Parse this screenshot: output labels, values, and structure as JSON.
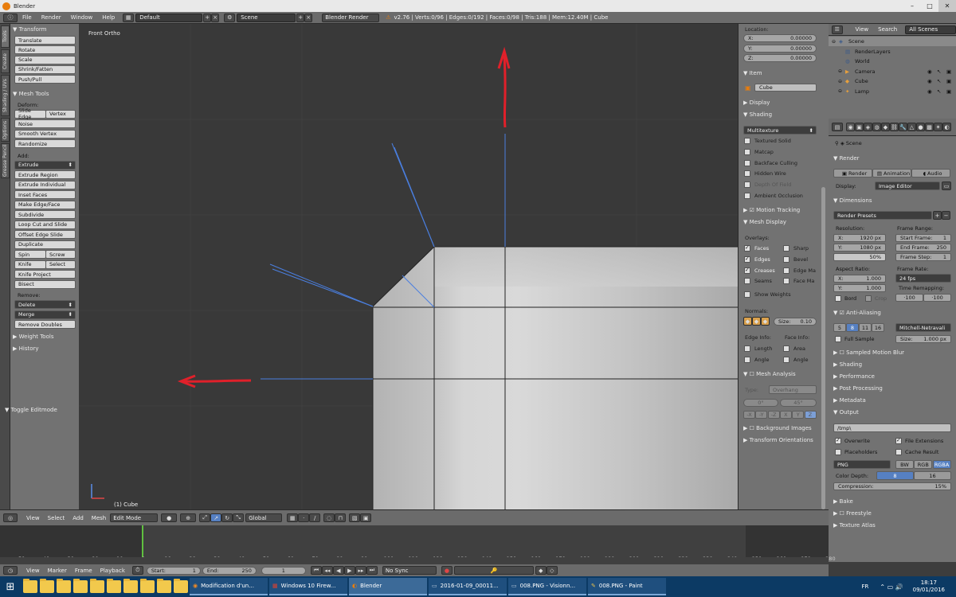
{
  "window": {
    "title": "Blender",
    "min": "–",
    "max": "□",
    "close": "✕"
  },
  "info_header": {
    "menus": [
      "File",
      "Render",
      "Window",
      "Help"
    ],
    "layout": "Default",
    "scene": "Scene",
    "engine": "Blender Render",
    "stats": "v2.76 | Verts:0/96 | Edges:0/192 | Faces:0/98 | Tris:188 | Mem:12.40M | Cube"
  },
  "tool_tabs": [
    "Tools",
    "Create",
    "Shading / UVs",
    "Options",
    "Grease Pencil"
  ],
  "tools": {
    "transform": {
      "title": "Transform",
      "buttons": [
        "Translate",
        "Rotate",
        "Scale",
        "Shrink/Fatten",
        "Push/Pull"
      ]
    },
    "mesh_tools": {
      "title": "Mesh Tools",
      "deform_label": "Deform:",
      "deform": [
        [
          "Slide Edge",
          "Vertex"
        ],
        [
          "Noise"
        ],
        [
          "Smooth Vertex"
        ],
        [
          "Randomize"
        ]
      ],
      "add_label": "Add:",
      "extrude": "Extrude",
      "add": [
        "Extrude Region",
        "Extrude Individual",
        "Inset Faces",
        "Make Edge/Face",
        "Subdivide",
        "Loop Cut and Slide",
        "Offset Edge Slide",
        "Duplicate"
      ],
      "pairs": [
        [
          "Spin",
          "Screw"
        ],
        [
          "Knife",
          "Select"
        ]
      ],
      "after_pairs": [
        "Knife Project",
        "Bisect"
      ],
      "remove_label": "Remove:",
      "delete": "Delete",
      "merge": "Merge",
      "remove_doubles": "Remove Doubles"
    },
    "weight_tools": "Weight Tools",
    "history": "History",
    "toggle": "Toggle Editmode"
  },
  "viewport": {
    "view_name": "Front Ortho",
    "object_label": "(1) Cube"
  },
  "n_panel": {
    "location_label": "Location:",
    "location": [
      {
        "axis": "X:",
        "value": "0.00000"
      },
      {
        "axis": "Y:",
        "value": "0.00000"
      },
      {
        "axis": "Z:",
        "value": "0.00000"
      }
    ],
    "item_title": "Item",
    "item_name": "Cube",
    "display_title": "Display",
    "shading_title": "Shading",
    "shading_mode": "Multitexture",
    "shading_opts": [
      "Textured Solid",
      "Matcap",
      "Backface Culling",
      "Hidden Wire",
      "Depth Of Field",
      "Ambient Occlusion"
    ],
    "motion_tracking": "Motion Tracking",
    "mesh_display_title": "Mesh Display",
    "overlays_label": "Overlays:",
    "overlays_left": [
      {
        "label": "Faces",
        "on": true
      },
      {
        "label": "Edges",
        "on": true
      },
      {
        "label": "Creases",
        "on": true
      },
      {
        "label": "Seams",
        "on": false
      }
    ],
    "overlays_right": [
      {
        "label": "Sharp",
        "on": false
      },
      {
        "label": "Bevel",
        "on": false
      },
      {
        "label": "Edge Ma",
        "on": false
      },
      {
        "label": "Face Ma",
        "on": false
      }
    ],
    "show_weights": "Show Weights",
    "normals_label": "Normals:",
    "normals_size": "Size:",
    "normals_size_value": "0.10",
    "edge_info": "Edge Info:",
    "face_info": "Face Info:",
    "edge_info_opts": [
      "Length",
      "Angle"
    ],
    "face_info_opts": [
      "Area",
      "Angle"
    ],
    "mesh_analysis": "Mesh Analysis",
    "type_label": "Type:",
    "type_value": "Overhang",
    "angle_min": "0°",
    "angle_max": "45°",
    "axes": [
      "-X",
      "-Y",
      "-Z",
      "X",
      "Y",
      "Z"
    ],
    "background_images": "Background Images",
    "transform_orientations": "Transform Orientations"
  },
  "outliner": {
    "menus": [
      "View",
      "Search"
    ],
    "filter": "All Scenes",
    "rows": [
      {
        "name": "Scene",
        "indent": 0
      },
      {
        "name": "RenderLayers",
        "indent": 1
      },
      {
        "name": "World",
        "indent": 1
      },
      {
        "name": "Camera",
        "indent": 1
      },
      {
        "name": "Cube",
        "indent": 1
      },
      {
        "name": "Lamp",
        "indent": 1
      }
    ]
  },
  "properties": {
    "breadcrumb": "Scene",
    "render_title": "Render",
    "render_btns": [
      "Render",
      "Animation",
      "Audio"
    ],
    "display_label": "Display:",
    "display_value": "Image Editor",
    "dimensions_title": "Dimensions",
    "render_presets": "Render Presets",
    "resolution_label": "Resolution:",
    "res_x": "1920 px",
    "res_y": "1080 px",
    "res_pct": "50%",
    "frame_range_label": "Frame Range:",
    "start_frame": "Start Frame:",
    "start_frame_value": "1",
    "end_frame": "End Frame:",
    "end_frame_value": "250",
    "frame_step": "Frame Step:",
    "frame_step_value": "1",
    "aspect_label": "Aspect Ratio:",
    "aspect_x": "1.000",
    "aspect_y": "1.000",
    "frame_rate_label": "Frame Rate:",
    "frame_rate": "24 fps",
    "time_remap_label": "Time Remapping:",
    "time_old": "·100",
    "time_new": "·100",
    "bord": "Bord",
    "crop": "Crop",
    "aa_title": "Anti-Aliasing",
    "aa_samples": [
      "5",
      "8",
      "11",
      "16"
    ],
    "aa_filter": "Mitchell-Netravali",
    "full_sample": "Full Sample",
    "aa_size": "Size:",
    "aa_size_value": "1.000 px",
    "collapsed": [
      "Sampled Motion Blur",
      "Shading",
      "Performance",
      "Post Processing",
      "Metadata"
    ],
    "output_title": "Output",
    "output_path": "/tmp\\",
    "overwrite": "Overwrite",
    "file_ext": "File Extensions",
    "placeholders": "Placeholders",
    "cache_result": "Cache Result",
    "format": "PNG",
    "color_modes": [
      "BW",
      "RGB",
      "RGBA"
    ],
    "color_depth_label": "Color Depth:",
    "color_depths": [
      "8",
      "16"
    ],
    "compression_label": "Compression:",
    "compression_value": "15%",
    "bake": "Bake",
    "freestyle": "Freestyle",
    "texture_atlas": "Texture Atlas"
  },
  "viewport_header": {
    "menus": [
      "View",
      "Select",
      "Add",
      "Mesh"
    ],
    "mode": "Edit Mode",
    "orientation": "Global"
  },
  "timeline": {
    "ticks": [
      "-50",
      "-40",
      "-30",
      "-20",
      "-10",
      "0",
      "10",
      "20",
      "30",
      "40",
      "50",
      "60",
      "70",
      "80",
      "90",
      "100",
      "110",
      "120",
      "130",
      "140",
      "150",
      "160",
      "170",
      "180",
      "190",
      "200",
      "210",
      "220",
      "230",
      "240",
      "250",
      "260",
      "270",
      "280"
    ],
    "menus": [
      "View",
      "Marker",
      "Frame",
      "Playback"
    ],
    "start_label": "Start:",
    "start_value": "1",
    "end_label": "End:",
    "end_value": "250",
    "current": "1",
    "sync": "No Sync"
  },
  "taskbar": {
    "apps": [
      "Modification d'un...",
      "Windows 10 Firew...",
      "Blender",
      "2016-01-09_00011...",
      "008.PNG - Visionn...",
      "008.PNG - Paint"
    ],
    "lang": "FR",
    "time": "18:17",
    "date": "09/01/2016"
  },
  "colors": {
    "accent": "#5680c2",
    "arrow": "#e0202a",
    "blender_orange": "#e87d0d"
  }
}
